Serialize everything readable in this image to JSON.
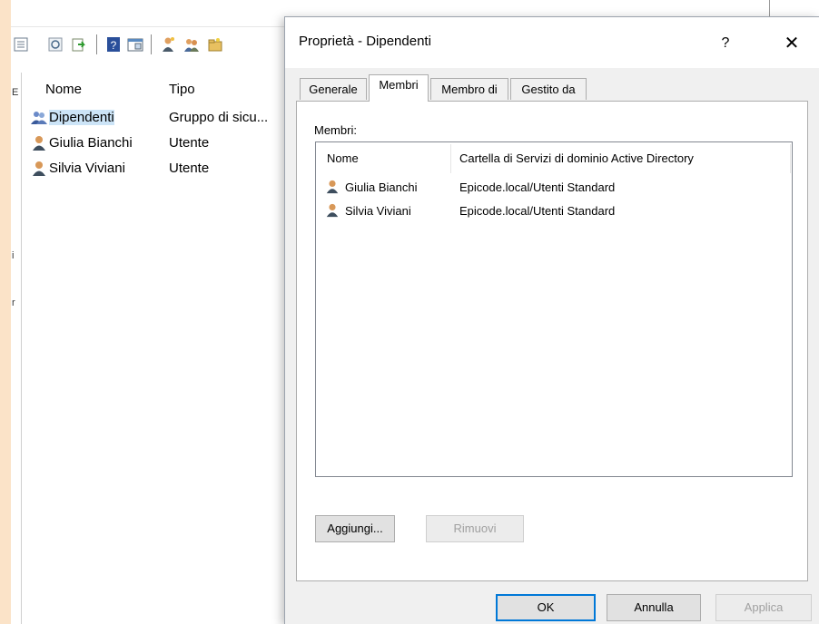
{
  "background": {
    "left_fragments": [
      "E",
      "i",
      "r"
    ],
    "list": {
      "columns": [
        "Nome",
        "Tipo"
      ],
      "rows": [
        {
          "name": "Dipendenti",
          "type": "Gruppo di sicu...",
          "icon": "group-icon"
        },
        {
          "name": "Giulia Bianchi",
          "type": "Utente",
          "icon": "user-icon"
        },
        {
          "name": "Silvia Viviani",
          "type": "Utente",
          "icon": "user-icon"
        }
      ]
    }
  },
  "dialog": {
    "title": "Proprietà - Dipendenti",
    "help": "?",
    "close": "✕",
    "tabs": [
      "Generale",
      "Membri",
      "Membro di",
      "Gestito da"
    ],
    "active_tab": "Membri",
    "members_label": "Membri:",
    "list": {
      "columns": [
        "Nome",
        "Cartella di Servizi di dominio Active Directory"
      ],
      "rows": [
        {
          "name": "Giulia Bianchi",
          "folder": "Epicode.local/Utenti Standard"
        },
        {
          "name": "Silvia Viviani",
          "folder": "Epicode.local/Utenti Standard"
        }
      ]
    },
    "buttons": {
      "add": "Aggiungi...",
      "remove": "Rimuovi",
      "ok": "OK",
      "cancel": "Annulla",
      "apply": "Applica"
    }
  },
  "colors": {
    "desktop": "#fbe3c8",
    "selection": "#cce4f7",
    "accent": "#0078d7",
    "dialog_bg": "#f0f0f0"
  }
}
